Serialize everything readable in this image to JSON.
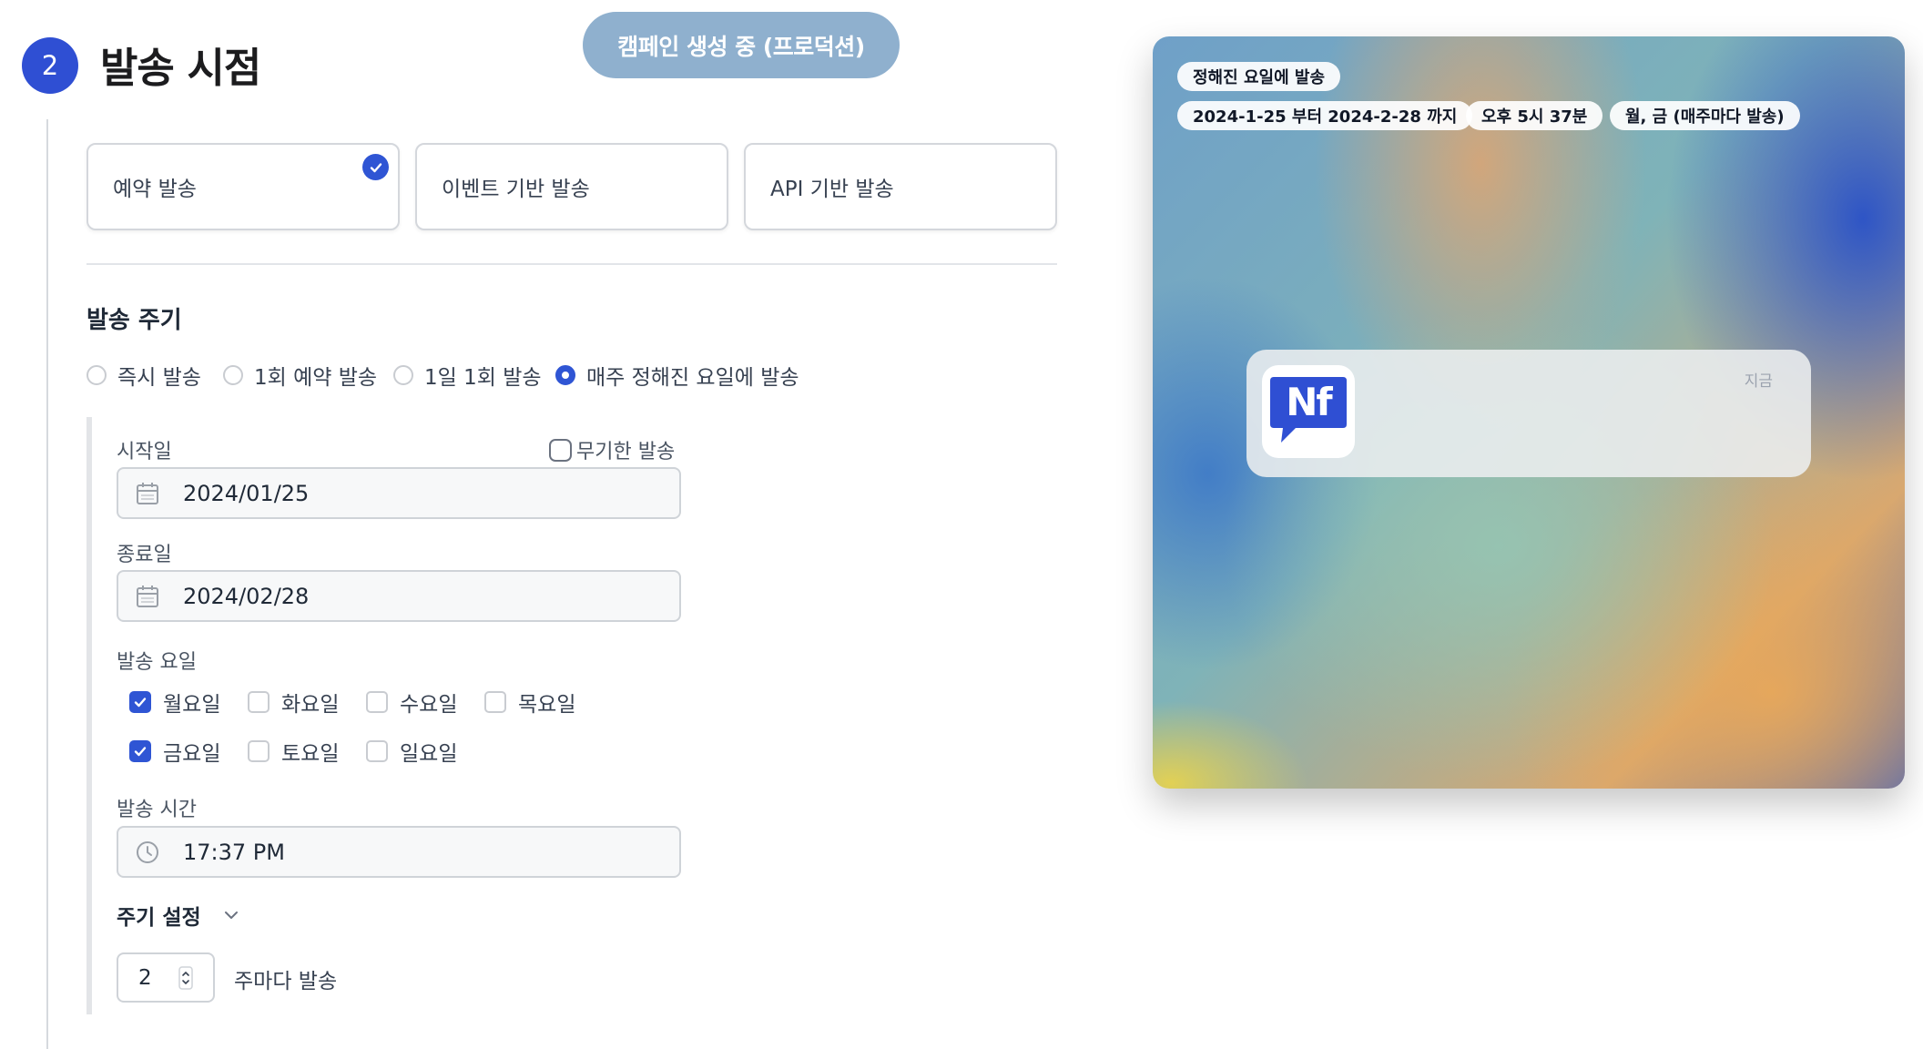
{
  "step": {
    "number": "2",
    "title": "발송 시점"
  },
  "banner": {
    "text": "캠페인 생성 중 (프로덕션)",
    "color": "#8fb0ce"
  },
  "send_types": [
    {
      "label": "예약 발송",
      "selected": true
    },
    {
      "label": "이벤트 기반 발송",
      "selected": false
    },
    {
      "label": "API 기반 발송",
      "selected": false
    }
  ],
  "cycle": {
    "title": "발송 주기",
    "options": [
      {
        "label": "즉시 발송",
        "selected": false
      },
      {
        "label": "1회 예약 발송",
        "selected": false
      },
      {
        "label": "1일 1회 발송",
        "selected": false
      },
      {
        "label": "매주 정해진 요일에 발송",
        "selected": true
      }
    ]
  },
  "schedule": {
    "start_label": "시작일",
    "start_value": "2024/01/25",
    "infinite_label": "무기한 발송",
    "end_label": "종료일",
    "end_value": "2024/02/28",
    "days_label": "발송 요일",
    "days": [
      {
        "label": "월요일",
        "checked": true
      },
      {
        "label": "화요일",
        "checked": false
      },
      {
        "label": "수요일",
        "checked": false
      },
      {
        "label": "목요일",
        "checked": false
      },
      {
        "label": "금요일",
        "checked": true
      },
      {
        "label": "토요일",
        "checked": false
      },
      {
        "label": "일요일",
        "checked": false
      }
    ],
    "time_label": "발송 시간",
    "time_value": "17:37 PM",
    "period_label": "주기 설정",
    "period_value": "2",
    "period_suffix": "주마다 발송"
  },
  "preview": {
    "pills": [
      "정해진 요일에 발송",
      "2024-1-25 부터 2024-2-28 까지",
      "오후 5시 37분",
      "월, 금 (매주마다 발송)"
    ],
    "notification_time": "지금",
    "app_icon_text": "Nf"
  },
  "colors": {
    "accent": "#2f55d4",
    "step": "#2f4fd3"
  }
}
